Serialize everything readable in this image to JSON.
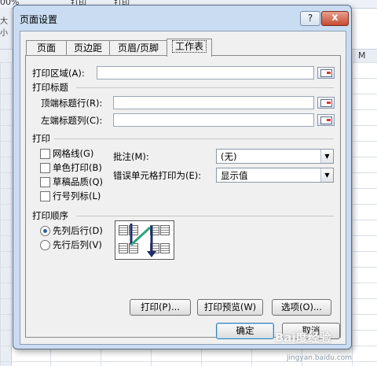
{
  "background": {
    "zoom_text": "00%",
    "top_text_1": "打印",
    "top_text_2": "打印",
    "column_m": "M",
    "side_text": "大小"
  },
  "dialog": {
    "title": "页面设置",
    "help_label": "?",
    "close_label": "x",
    "tabs": [
      {
        "label": "页面"
      },
      {
        "label": "页边距"
      },
      {
        "label": "页眉/页脚"
      },
      {
        "label": "工作表",
        "active": true
      }
    ],
    "print_area": {
      "label": "打印区域(A):",
      "value": ""
    },
    "print_titles": {
      "section_label": "打印标题",
      "top_rows": {
        "label": "顶端标题行(R):",
        "value": ""
      },
      "left_cols": {
        "label": "左端标题列(C):",
        "value": ""
      }
    },
    "print": {
      "section_label": "打印",
      "gridlines": {
        "label": "网格线(G)",
        "checked": false
      },
      "black_white": {
        "label": "单色打印(B)",
        "checked": false
      },
      "draft": {
        "label": "草稿品质(Q)",
        "checked": false
      },
      "headings": {
        "label": "行号列标(L)",
        "checked": false
      },
      "comments": {
        "label": "批注(M):",
        "value": "(无)"
      },
      "errors": {
        "label": "错误单元格打印为(E):",
        "value": "显示值"
      }
    },
    "page_order": {
      "section_label": "打印顺序",
      "down_then_over": {
        "label": "先列后行(D)",
        "selected": true
      },
      "over_then_down": {
        "label": "先行后列(V)",
        "selected": false
      }
    },
    "buttons": {
      "print": "打印(P)...",
      "preview": "打印预览(W)",
      "options": "选项(O)...",
      "ok": "确定",
      "cancel": "取消"
    }
  },
  "watermark": {
    "text": "Bai度经验",
    "url": "jingyan.baidu.com"
  }
}
